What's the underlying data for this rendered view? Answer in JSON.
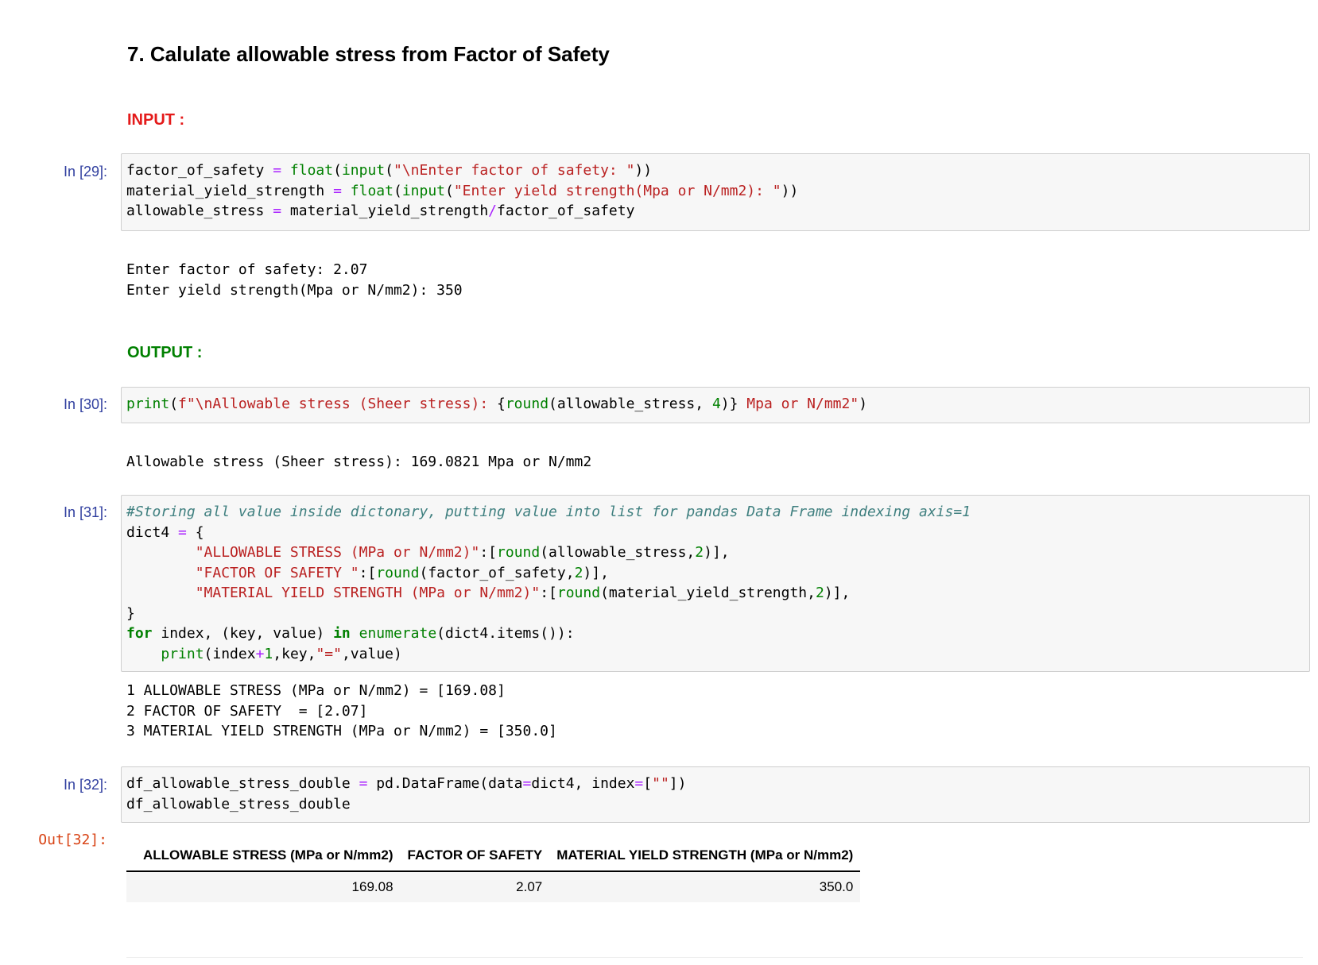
{
  "heading": "7. Calulate allowable stress from Factor of Safety",
  "sections": {
    "input_label": "INPUT :",
    "input_color": "#e41a1a",
    "output_label": "OUTPUT :",
    "output_color": "#008000"
  },
  "cells": [
    {
      "prompt": "In [29]:",
      "lines": [
        [
          [
            "n",
            "factor_of_safety "
          ],
          [
            "op",
            "="
          ],
          [
            "n",
            " "
          ],
          [
            "bi",
            "float"
          ],
          [
            "n",
            "("
          ],
          [
            "bi",
            "input"
          ],
          [
            "n",
            "("
          ],
          [
            "str",
            "\"\\nEnter factor of safety: \""
          ],
          [
            "n",
            "))"
          ]
        ],
        [
          [
            "n",
            "material_yield_strength "
          ],
          [
            "op",
            "="
          ],
          [
            "n",
            " "
          ],
          [
            "bi",
            "float"
          ],
          [
            "n",
            "("
          ],
          [
            "bi",
            "input"
          ],
          [
            "n",
            "("
          ],
          [
            "str",
            "\"Enter yield strength(Mpa or N/mm2): \""
          ],
          [
            "n",
            "))"
          ]
        ],
        [
          [
            "n",
            "allowable_stress "
          ],
          [
            "op",
            "="
          ],
          [
            "n",
            " material_yield_strength"
          ],
          [
            "op",
            "/"
          ],
          [
            "n",
            "factor_of_safety"
          ]
        ]
      ],
      "output": [
        "Enter factor of safety: 2.07",
        "Enter yield strength(Mpa or N/mm2): 350"
      ]
    },
    {
      "prompt": "In [30]:",
      "lines": [
        [
          [
            "bi",
            "print"
          ],
          [
            "n",
            "("
          ],
          [
            "str",
            "f\"\\nAllowable stress (Sheer stress): "
          ],
          [
            "n",
            "{"
          ],
          [
            "bi",
            "round"
          ],
          [
            "n",
            "(allowable_stress, "
          ],
          [
            "num",
            "4"
          ],
          [
            "n",
            ")}"
          ],
          [
            "str",
            " Mpa or N/mm2\""
          ],
          [
            "n",
            ")"
          ]
        ]
      ],
      "output": [
        "Allowable stress (Sheer stress): 169.0821 Mpa or N/mm2"
      ]
    },
    {
      "prompt": "In [31]:",
      "lines": [
        [
          [
            "cm",
            "#Storing all value inside dictonary, putting value into list for pandas Data Frame indexing axis=1"
          ]
        ],
        [
          [
            "n",
            "dict4 "
          ],
          [
            "op",
            "="
          ],
          [
            "n",
            " {"
          ]
        ],
        [
          [
            "n",
            "        "
          ],
          [
            "str",
            "\"ALLOWABLE STRESS (MPa or N/mm2)\""
          ],
          [
            "n",
            ":["
          ],
          [
            "bi",
            "round"
          ],
          [
            "n",
            "(allowable_stress,"
          ],
          [
            "num",
            "2"
          ],
          [
            "n",
            ")],"
          ]
        ],
        [
          [
            "n",
            "        "
          ],
          [
            "str",
            "\"FACTOR OF SAFETY \""
          ],
          [
            "n",
            ":["
          ],
          [
            "bi",
            "round"
          ],
          [
            "n",
            "(factor_of_safety,"
          ],
          [
            "num",
            "2"
          ],
          [
            "n",
            ")],"
          ]
        ],
        [
          [
            "n",
            "        "
          ],
          [
            "str",
            "\"MATERIAL YIELD STRENGTH (MPa or N/mm2)\""
          ],
          [
            "n",
            ":["
          ],
          [
            "bi",
            "round"
          ],
          [
            "n",
            "(material_yield_strength,"
          ],
          [
            "num",
            "2"
          ],
          [
            "n",
            ")],"
          ]
        ],
        [
          [
            "n",
            "}"
          ]
        ],
        [
          [
            "kw",
            "for"
          ],
          [
            "n",
            " index, (key, value) "
          ],
          [
            "kw",
            "in"
          ],
          [
            "n",
            " "
          ],
          [
            "bi",
            "enumerate"
          ],
          [
            "n",
            "(dict4.items()):"
          ]
        ],
        [
          [
            "n",
            "    "
          ],
          [
            "bi",
            "print"
          ],
          [
            "n",
            "(index"
          ],
          [
            "op",
            "+"
          ],
          [
            "num",
            "1"
          ],
          [
            "n",
            ",key,"
          ],
          [
            "str",
            "\"=\""
          ],
          [
            "n",
            ",value)"
          ]
        ]
      ],
      "output": [
        "1 ALLOWABLE STRESS (MPa or N/mm2) = [169.08]",
        "2 FACTOR OF SAFETY  = [2.07]",
        "3 MATERIAL YIELD STRENGTH (MPa or N/mm2) = [350.0]"
      ]
    },
    {
      "prompt": "In [32]:",
      "lines": [
        [
          [
            "n",
            "df_allowable_stress_double "
          ],
          [
            "op",
            "="
          ],
          [
            "n",
            " pd.DataFrame(data"
          ],
          [
            "op",
            "="
          ],
          [
            "n",
            "dict4, index"
          ],
          [
            "op",
            "="
          ],
          [
            "n",
            "["
          ],
          [
            "str",
            "\"\""
          ],
          [
            "n",
            "])"
          ]
        ],
        [
          [
            "n",
            "df_allowable_stress_double"
          ]
        ]
      ],
      "output": []
    }
  ],
  "out_prompt": "Out[32]:",
  "dataframe": {
    "index_header": "",
    "columns": [
      "ALLOWABLE STRESS (MPa or N/mm2)",
      "FACTOR OF SAFETY",
      "MATERIAL YIELD STRENGTH (MPa or N/mm2)"
    ],
    "rows": [
      {
        "index": "",
        "values": [
          "169.08",
          "2.07",
          "350.0"
        ]
      }
    ]
  },
  "colors": {
    "prompt_in": "#303f9f",
    "prompt_out": "#d84315",
    "cell_bg": "#f7f7f7",
    "cell_border": "#cfcfcf",
    "string": "#ba2121",
    "builtin": "#008000",
    "operator": "#aa22ff",
    "comment": "#408080"
  }
}
